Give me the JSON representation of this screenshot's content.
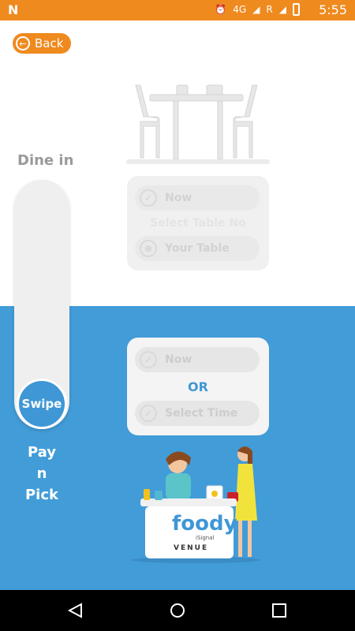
{
  "status_bar": {
    "left_icon": "N",
    "network": "4G",
    "roaming": "R",
    "time": "5:55"
  },
  "back_button": {
    "label": "Back"
  },
  "slider": {
    "top_label": "Dine in",
    "knob_label": "Swipe",
    "bottom_label": "Pay\nn\nPick"
  },
  "dine_in_card": {
    "now_label": "Now",
    "section_label": "Select Table No",
    "table_label": "Your Table"
  },
  "pay_card": {
    "now_label": "Now",
    "or_label": "OR",
    "time_label": "Select Time"
  },
  "illustration": {
    "brand_word": "foody",
    "brand_sub": "iSignal",
    "venue": "VENUE"
  },
  "colors": {
    "accent": "#ef8a1f",
    "primary": "#3f97d6"
  }
}
